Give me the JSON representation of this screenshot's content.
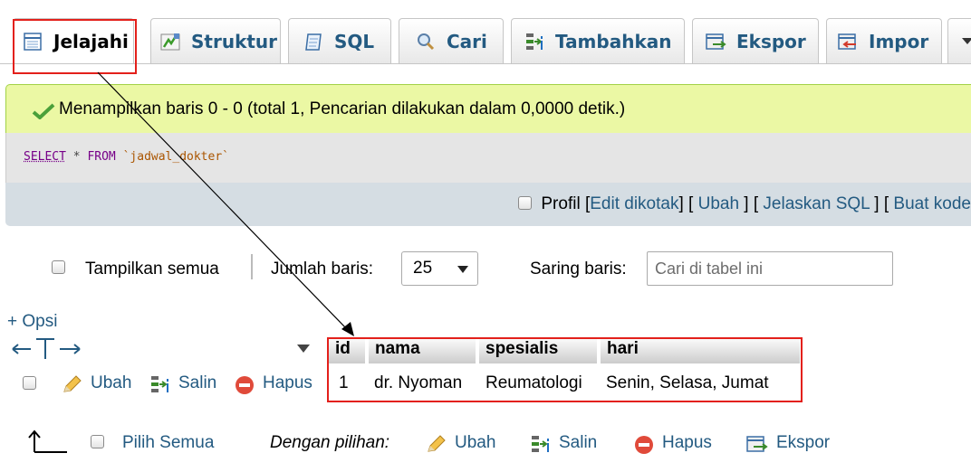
{
  "tabs": [
    {
      "label": "Jelajahi",
      "icon": "browse-icon"
    },
    {
      "label": "Struktur",
      "icon": "structure-icon"
    },
    {
      "label": "SQL",
      "icon": "sql-icon"
    },
    {
      "label": "Cari",
      "icon": "search-icon"
    },
    {
      "label": "Tambahkan",
      "icon": "insert-icon"
    },
    {
      "label": "Ekspor",
      "icon": "export-icon"
    },
    {
      "label": "Impor",
      "icon": "import-icon"
    }
  ],
  "success_message": "Menampilkan baris 0 - 0 (total 1, Pencarian dilakukan dalam 0,0000 detik.)",
  "sql": {
    "select": "SELECT",
    "star": "*",
    "from": "FROM",
    "table": "`jadwal_dokter`"
  },
  "sql_actions": {
    "profil": "Profil",
    "edit_inline": "Edit dikotak",
    "edit": "Ubah",
    "explain": "Jelaskan SQL",
    "create_code": "Buat kode"
  },
  "nav": {
    "show_all": "Tampilkan semua",
    "rows_label": "Jumlah baris:",
    "rows_value": "25",
    "filter_label": "Saring baris:",
    "filter_placeholder": "Cari di tabel ini"
  },
  "options_link": "+ Opsi",
  "columns": [
    "id",
    "nama",
    "spesialis",
    "hari"
  ],
  "rows": [
    {
      "actions": {
        "edit": "Ubah",
        "copy": "Salin",
        "delete": "Hapus"
      },
      "cells": [
        "1",
        "dr. Nyoman",
        "Reumatologi",
        "Senin, Selasa, Jumat"
      ]
    }
  ],
  "bottom": {
    "check_all": "Pilih Semua",
    "with_selected": "Dengan pilihan:",
    "edit": "Ubah",
    "copy": "Salin",
    "delete": "Hapus",
    "export": "Ekspor"
  },
  "colors": {
    "link": "#235a81",
    "highlight": "#e3201b",
    "success_bg": "#ebf8a4"
  }
}
